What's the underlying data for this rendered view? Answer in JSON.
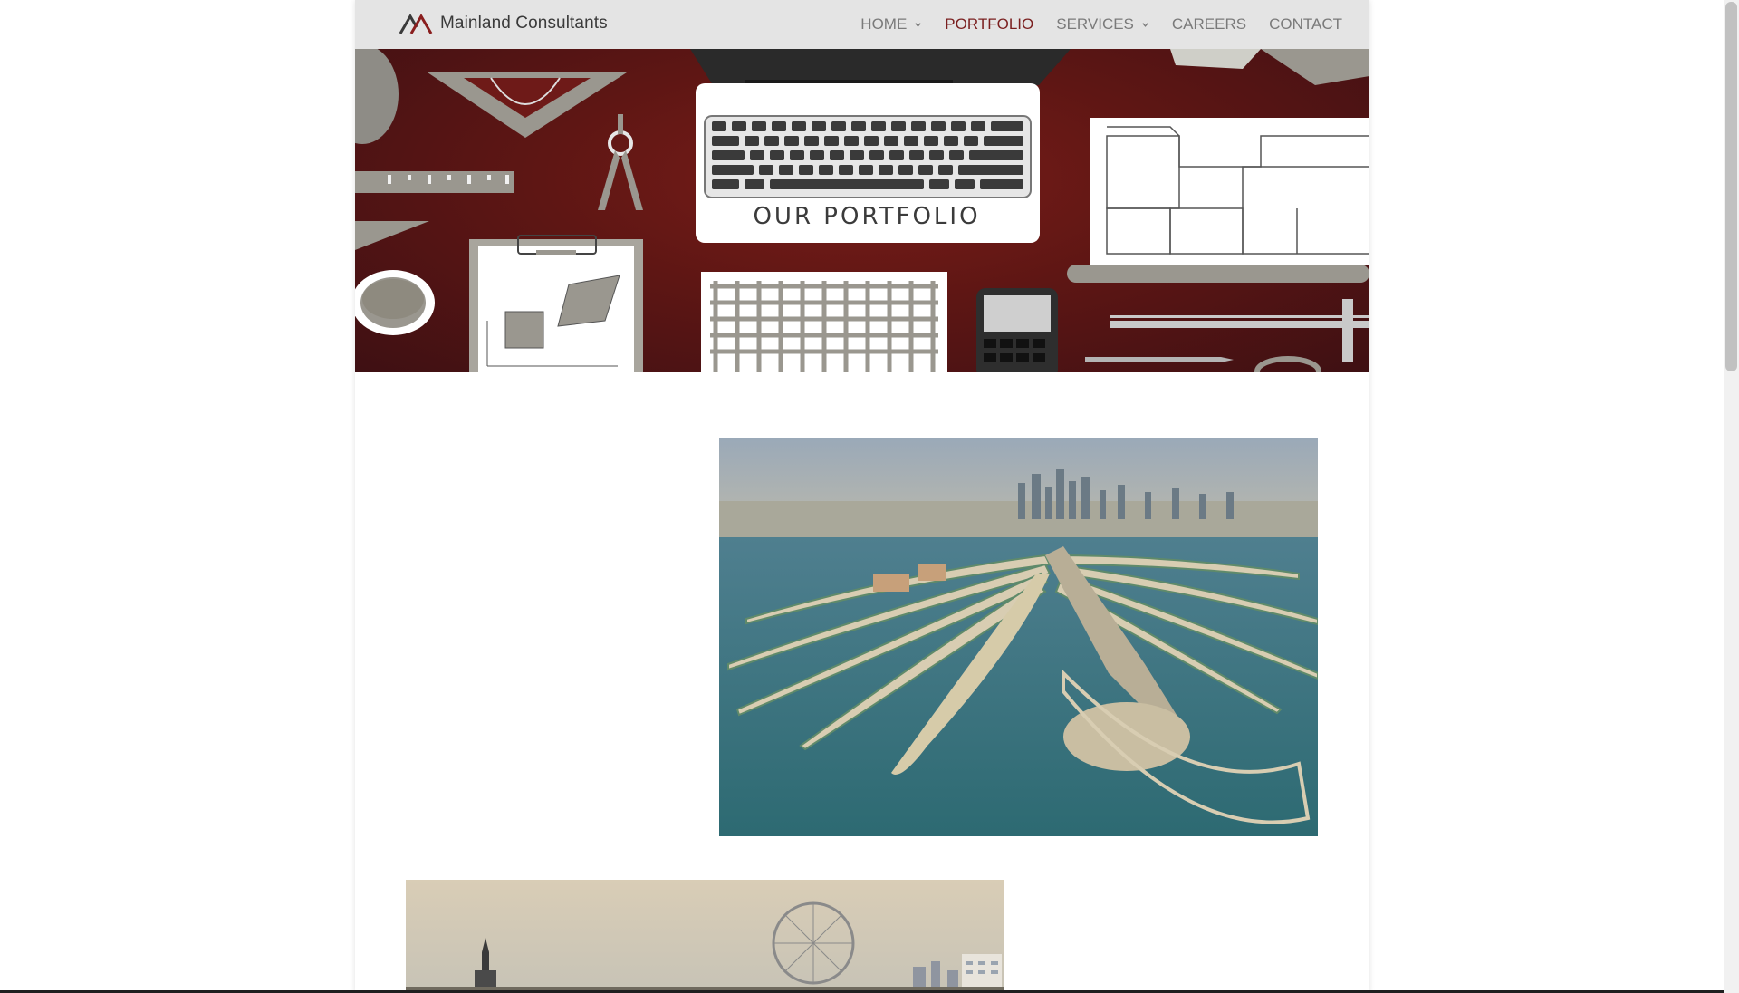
{
  "header": {
    "logo_text": "Mainland Consultants",
    "nav": [
      {
        "label": "HOME",
        "has_dropdown": true,
        "active": false
      },
      {
        "label": "PORTFOLIO",
        "has_dropdown": false,
        "active": true
      },
      {
        "label": "SERVICES",
        "has_dropdown": true,
        "active": false
      },
      {
        "label": "CAREERS",
        "has_dropdown": false,
        "active": false
      },
      {
        "label": "CONTACT",
        "has_dropdown": false,
        "active": false
      }
    ]
  },
  "hero": {
    "title": "OUR PORTFOLIO"
  },
  "colors": {
    "header_bg": "#e4e4e4",
    "active_nav": "#7a1f1f",
    "nav_text": "#7a7a7a",
    "hero_bg": "#5e1614"
  },
  "icons": {
    "logo": "mountain-logo-icon",
    "chevron": "chevron-down-icon"
  }
}
